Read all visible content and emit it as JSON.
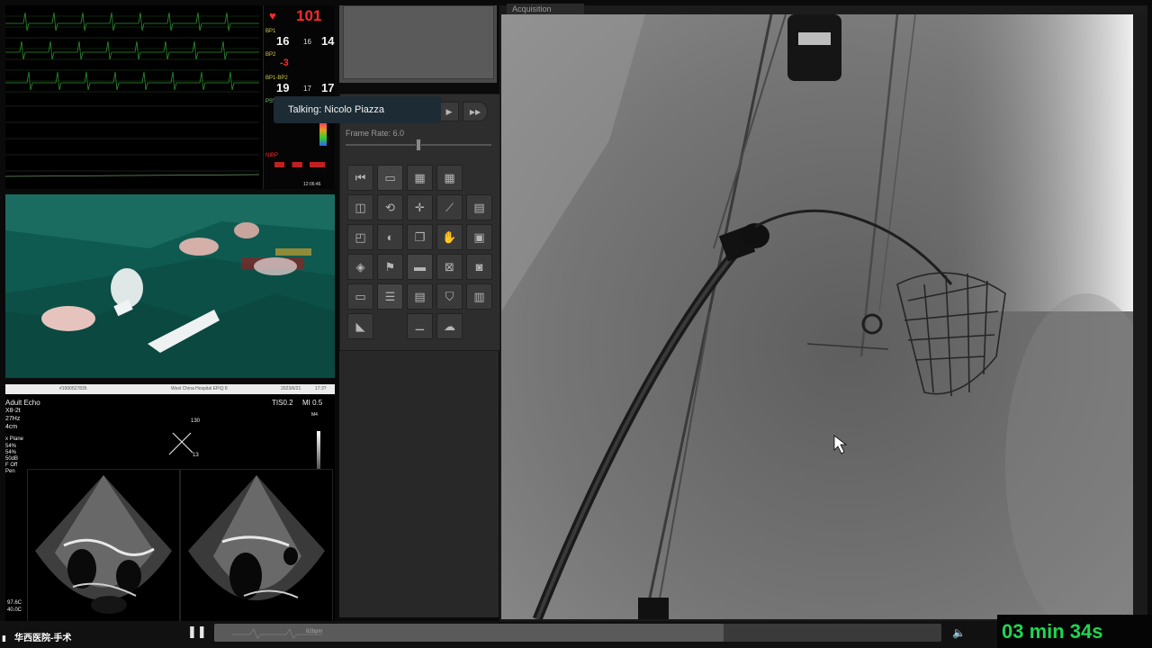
{
  "monitor": {
    "heart_rate": "101",
    "bp1": {
      "label": "BP1",
      "systolic": "16",
      "mean": "16",
      "diastolic": "14"
    },
    "bp2": {
      "label": "BP2",
      "value": "-3"
    },
    "bp1_bp2": {
      "label": "BP1-BP2",
      "a": "19",
      "b": "17",
      "c": "17"
    },
    "pleth_label": "PSV",
    "nibp_label": "NIBP",
    "clock": "12:06:46"
  },
  "echo": {
    "header_id": "#1900527835",
    "header_hospital": "West China Hospital EPIQ 8",
    "header_date": "2023/6/21",
    "header_time": "17:3?",
    "mode": "Adult Echo",
    "probe": "X8-2t",
    "freq": "27Hz",
    "depth": "4cm",
    "tis": "TIS0.2",
    "mi": "MI 0.5",
    "plane_label": "x Plane",
    "p1": "54%",
    "p2": "54%",
    "db": "50dB",
    "off": "F Off",
    "pen": "Pen",
    "angle_top": "130",
    "angle_bottom": "13",
    "m4": "M4",
    "bottom_left_1": "97.6C",
    "bottom_left_2": "40.0C"
  },
  "controls": {
    "tooltip": "Talking: Nicolo Piazza",
    "frame_rate_label": "Frame Rate: 6.0",
    "frame_rate": 0.5
  },
  "angio": {
    "tab_label": "Acquisition"
  },
  "bottom": {
    "hospital_logo": "华西医院-手术",
    "hr_readout": "82bpm",
    "timer": "03 min 34s",
    "progress": 0.7
  }
}
